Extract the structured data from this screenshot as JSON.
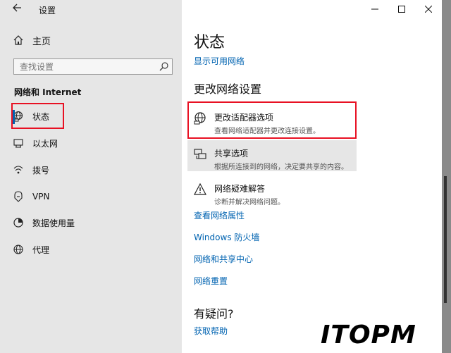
{
  "window": {
    "title": "设置"
  },
  "sidebar": {
    "home_label": "主页",
    "search_placeholder": "查找设置",
    "section_title": "网络和 Internet",
    "items": [
      {
        "label": "状态",
        "icon": "status-globe-icon",
        "active": true
      },
      {
        "label": "以太网",
        "icon": "ethernet-icon"
      },
      {
        "label": "拨号",
        "icon": "dialup-icon"
      },
      {
        "label": "VPN",
        "icon": "vpn-icon"
      },
      {
        "label": "数据使用量",
        "icon": "data-usage-icon"
      },
      {
        "label": "代理",
        "icon": "proxy-globe-icon"
      }
    ]
  },
  "content": {
    "page_title": "状态",
    "show_networks_link": "显示可用网络",
    "change_settings_heading": "更改网络设置",
    "settings": [
      {
        "title": "更改适配器选项",
        "desc": "查看网络适配器并更改连接设置。"
      },
      {
        "title": "共享选项",
        "desc": "根据所连接到的网络，决定要共享的内容。"
      },
      {
        "title": "网络疑难解答",
        "desc": "诊断并解决网络问题。"
      }
    ],
    "links": [
      "查看网络属性",
      "Windows 防火墙",
      "网络和共享中心",
      "网络重置"
    ],
    "help_heading": "有疑问?",
    "help_link": "获取帮助"
  },
  "watermark": {
    "text": "ITOPM"
  },
  "colors": {
    "accent": "#0063b1",
    "highlight": "#e81123",
    "sidebar_bg": "#e6e6e6",
    "logo": "#21a0d8"
  }
}
